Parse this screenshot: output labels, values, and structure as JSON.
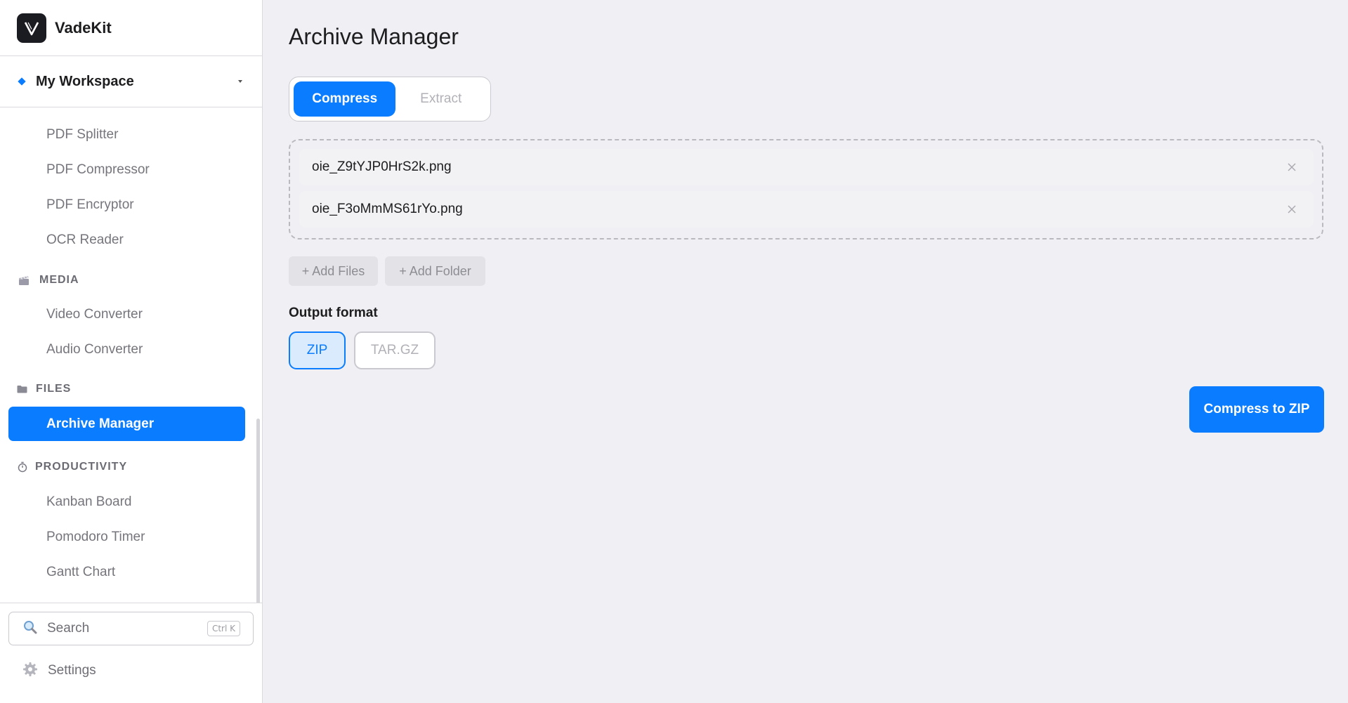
{
  "brand": {
    "name": "VadeKit",
    "logo_icon": "v-logo"
  },
  "workspace": {
    "label": "My Workspace"
  },
  "nav": {
    "items_top": [
      "PDF Splitter",
      "PDF Compressor",
      "PDF Encryptor",
      "OCR Reader"
    ],
    "media": {
      "title": "MEDIA",
      "items": [
        "Video Converter",
        "Audio Converter"
      ]
    },
    "files": {
      "title": "FILES",
      "items": [
        "Archive Manager"
      ]
    },
    "productivity": {
      "title": "PRODUCTIVITY",
      "items": [
        "Kanban Board",
        "Pomodoro Timer",
        "Gantt Chart"
      ]
    },
    "active": "Archive Manager"
  },
  "search": {
    "label": "Search",
    "shortcut": "Ctrl K"
  },
  "settings": {
    "label": "Settings"
  },
  "main": {
    "title": "Archive Manager",
    "tabs": [
      {
        "label": "Compress",
        "selected": true
      },
      {
        "label": "Extract",
        "selected": false
      }
    ],
    "files": [
      "oie_Z9tYJP0HrS2k.png",
      "oie_F3oMmMS61rYo.png"
    ],
    "add_files": "+ Add Files",
    "add_folder": "+ Add Folder",
    "output_label": "Output format",
    "formats": [
      {
        "label": "ZIP",
        "selected": true
      },
      {
        "label": "TAR.GZ",
        "selected": false
      }
    ],
    "primary_action": "Compress to ZIP"
  },
  "colors": {
    "accent": "#0a7cff",
    "sidebar_bg": "#ffffff",
    "main_bg": "#f0f0f4"
  }
}
